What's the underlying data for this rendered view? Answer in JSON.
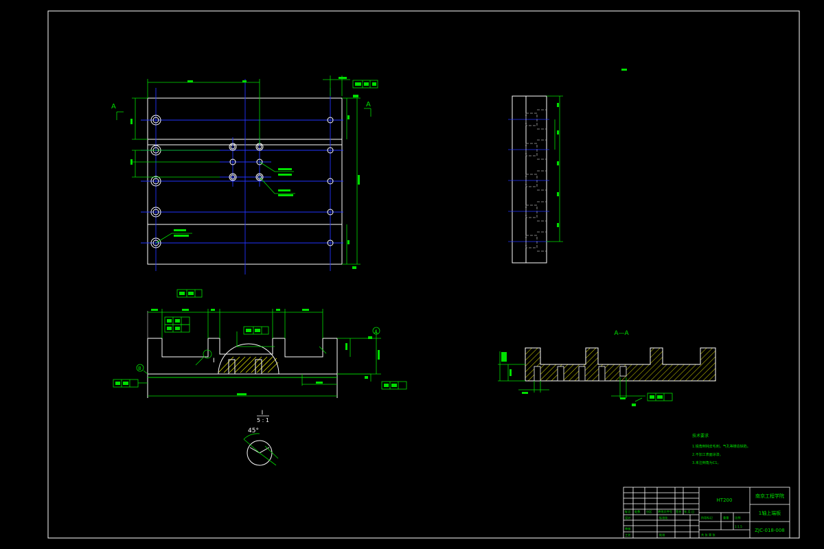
{
  "colors": {
    "background": "#000000",
    "outline": "#ffffff",
    "dimension": "#00ff00",
    "centerline": "#0000ff",
    "hatch": "#ffff00"
  },
  "labels": {
    "section_left": "A",
    "section_right": "A",
    "section_title": "A—A",
    "detail_mark": "I",
    "detail_title": "I",
    "detail_scale": "5 : 1",
    "detail_angle": "45°",
    "datum_a": "A",
    "datum_b": "B"
  },
  "notes": {
    "title": "技术要求",
    "items": [
      "1.锐角倒钝去毛刺，气孔等铸造缺陷。",
      "2.不加工表面涂漆。",
      "3.未注倒角为C1。"
    ]
  },
  "title_block": {
    "material": "HT200",
    "school": "南京工程学院",
    "part_name": "1轴上端板",
    "drawing_no": "ZJC-018-008",
    "scale": "1:1.5",
    "headers": [
      "标记",
      "处数",
      "分区",
      "更改文件号",
      "签名",
      "年.月.日"
    ],
    "rows": [
      "设计",
      "审核",
      "工艺"
    ],
    "std": "标准化",
    "approve": "批准",
    "stage": "阶段标记",
    "weight": "重量",
    "ratio": "比例",
    "sheet_info": "共 张 第 张"
  }
}
